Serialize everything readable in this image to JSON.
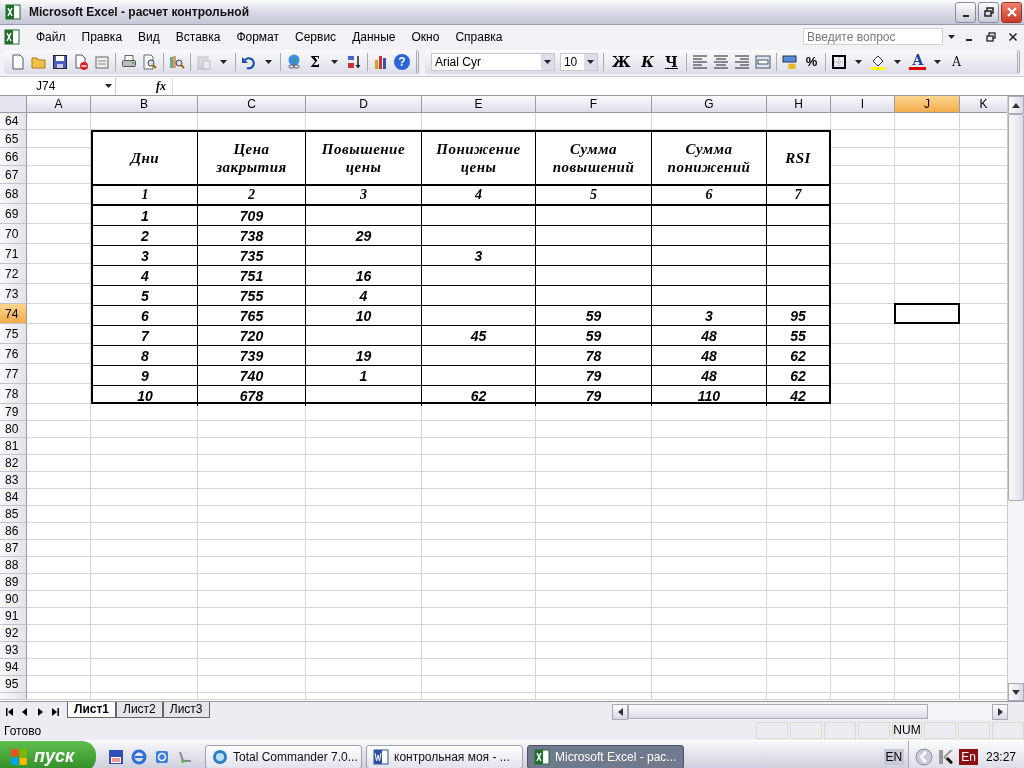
{
  "window": {
    "title": "Microsoft Excel - расчет контрольной"
  },
  "menu": {
    "items": [
      "Файл",
      "Правка",
      "Вид",
      "Вставка",
      "Формат",
      "Сервис",
      "Данные",
      "Окно",
      "Справка"
    ],
    "help_search": {
      "placeholder": "Введите вопрос"
    }
  },
  "toolbar": {
    "sum": "Σ",
    "help": "?",
    "font": "Arial Cyr",
    "size": "10",
    "bold": "Ж",
    "italic": "К",
    "underline": "Ч",
    "percent": "%",
    "font_color": "A",
    "font_size": "A"
  },
  "formula_bar": {
    "name_box": "J74",
    "function_label": "fx"
  },
  "sheet": {
    "columns": [
      {
        "label": "A",
        "selected": false
      },
      {
        "label": "B",
        "selected": false
      },
      {
        "label": "C",
        "selected": false
      },
      {
        "label": "D",
        "selected": false
      },
      {
        "label": "E",
        "selected": false
      },
      {
        "label": "F",
        "selected": false
      },
      {
        "label": "G",
        "selected": false
      },
      {
        "label": "H",
        "selected": false
      },
      {
        "label": "I",
        "selected": false
      },
      {
        "label": "J",
        "selected": true
      },
      {
        "label": "K",
        "selected": false
      }
    ],
    "rows": [
      {
        "label": "64",
        "selected": false
      },
      {
        "label": "65",
        "selected": false
      },
      {
        "label": "66",
        "selected": false
      },
      {
        "label": "67",
        "selected": false
      },
      {
        "label": "68",
        "selected": false
      },
      {
        "label": "69",
        "selected": false
      },
      {
        "label": "70",
        "selected": false
      },
      {
        "label": "71",
        "selected": false
      },
      {
        "label": "72",
        "selected": false
      },
      {
        "label": "73",
        "selected": false
      },
      {
        "label": "74",
        "selected": true
      },
      {
        "label": "75",
        "selected": false
      },
      {
        "label": "76",
        "selected": false
      },
      {
        "label": "77",
        "selected": false
      },
      {
        "label": "78",
        "selected": false
      },
      {
        "label": "79",
        "selected": false
      },
      {
        "label": "80",
        "selected": false
      },
      {
        "label": "81",
        "selected": false
      },
      {
        "label": "82",
        "selected": false
      },
      {
        "label": "83",
        "selected": false
      },
      {
        "label": "84",
        "selected": false
      },
      {
        "label": "85",
        "selected": false
      },
      {
        "label": "86",
        "selected": false
      },
      {
        "label": "87",
        "selected": false
      },
      {
        "label": "88",
        "selected": false
      },
      {
        "label": "89",
        "selected": false
      },
      {
        "label": "90",
        "selected": false
      },
      {
        "label": "91",
        "selected": false
      },
      {
        "label": "92",
        "selected": false
      },
      {
        "label": "93",
        "selected": false
      },
      {
        "label": "94",
        "selected": false
      },
      {
        "label": "95",
        "selected": false
      }
    ]
  },
  "table": {
    "headers": [
      {
        "text": "Дни",
        "number": "1"
      },
      {
        "text": "Цена закрытия",
        "number": "2"
      },
      {
        "text": "Повышение цены",
        "number": "3"
      },
      {
        "text": "Понижение цены",
        "number": "4"
      },
      {
        "text": "Сумма повышений",
        "number": "5"
      },
      {
        "text": "Сумма понижений",
        "number": "6"
      },
      {
        "text": "RSI",
        "number": "7"
      }
    ],
    "rows": [
      [
        "1",
        "709",
        null,
        null,
        null,
        null,
        null
      ],
      [
        "2",
        "738",
        "29",
        null,
        null,
        null,
        null
      ],
      [
        "3",
        "735",
        null,
        "3",
        null,
        null,
        null
      ],
      [
        "4",
        "751",
        "16",
        null,
        null,
        null,
        null
      ],
      [
        "5",
        "755",
        "4",
        null,
        null,
        null,
        null
      ],
      [
        "6",
        "765",
        "10",
        null,
        "59",
        "3",
        "95"
      ],
      [
        "7",
        "720",
        null,
        "45",
        "59",
        "48",
        "55"
      ],
      [
        "8",
        "739",
        "19",
        null,
        "78",
        "48",
        "62"
      ],
      [
        "9",
        "740",
        "1",
        null,
        "79",
        "48",
        "62"
      ],
      [
        "10",
        "678",
        null,
        "62",
        "79",
        "110",
        "42"
      ]
    ]
  },
  "sheet_tabs": [
    {
      "label": "Лист1",
      "selected": true
    },
    {
      "label": "Лист2",
      "selected": false
    },
    {
      "label": "Лист3",
      "selected": false
    }
  ],
  "status_bar": {
    "text": "Готово",
    "indicators": [
      "NUM"
    ]
  },
  "taskbar": {
    "start": "пуск",
    "tasks": [
      {
        "label": "Total Commander 7.0...",
        "kind": "commander",
        "selected": false
      },
      {
        "label": "контрольная моя - ...",
        "kind": "word",
        "selected": false
      },
      {
        "label": "Microsoft Excel - рас...",
        "kind": "excel",
        "selected": true
      }
    ],
    "language": "EN",
    "tray_language": "En",
    "clock": "23:27"
  }
}
